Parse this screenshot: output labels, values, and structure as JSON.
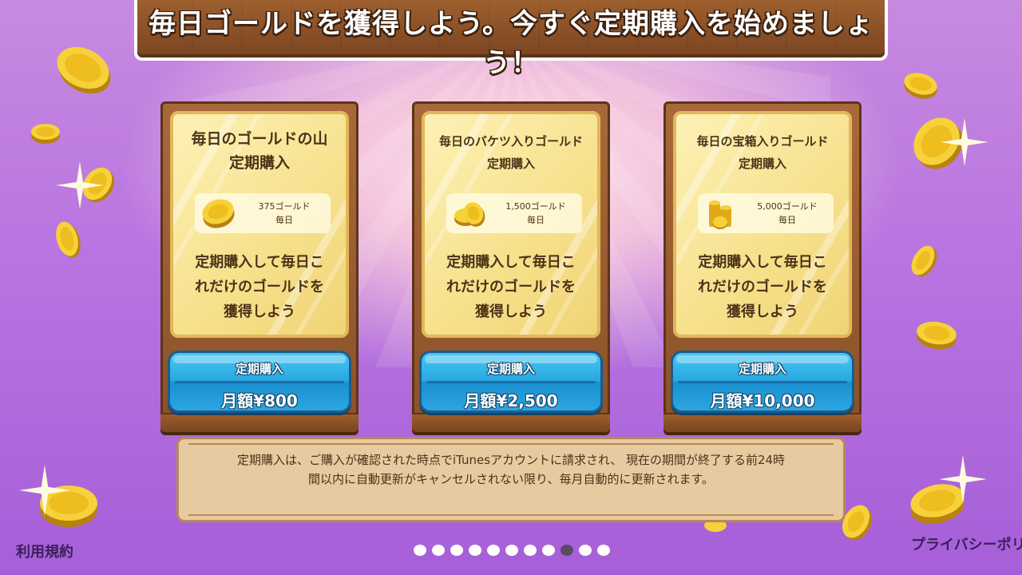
{
  "header": {
    "title": "毎日ゴールドを獲得しよう。今すぐ定期購入を始めましょう！"
  },
  "plans": [
    {
      "title_line1": "毎日のゴールドの山",
      "title_line2": "定期購入",
      "amount": "375ゴールド",
      "period": "毎日",
      "desc_line1": "定期購入して毎日こ",
      "desc_line2": "れだけのゴールドを",
      "desc_line3": "獲得しよう",
      "button_label": "定期購入",
      "price": "月額¥800",
      "icon": "single-coin-icon"
    },
    {
      "title_line1": "毎日のバケツ入りゴールド",
      "title_line2": "定期購入",
      "amount": "1,500ゴールド",
      "period": "毎日",
      "desc_line1": "定期購入して毎日こ",
      "desc_line2": "れだけのゴールドを",
      "desc_line3": "獲得しよう",
      "button_label": "定期購入",
      "price": "月額¥2,500",
      "icon": "coin-pair-icon"
    },
    {
      "title_line1": "毎日の宝箱入りゴールド",
      "title_line2": "定期購入",
      "amount": "5,000ゴールド",
      "period": "毎日",
      "desc_line1": "定期購入して毎日こ",
      "desc_line2": "れだけのゴールドを",
      "desc_line3": "獲得しよう",
      "button_label": "定期購入",
      "price": "月額¥10,000",
      "icon": "coin-stack-icon"
    }
  ],
  "notice": {
    "line1": "定期購入は、ご購入が確認された時点でiTunesアカウントに請求され、 現在の期間が終了する前24時",
    "line2": "間以内に自動更新がキャンセルされない限り、毎月自動的に更新されます。"
  },
  "footer": {
    "terms": "利用規約",
    "privacy": "プライバシーポリシー"
  },
  "pagination": {
    "total": 11,
    "active_index": 9
  },
  "colors": {
    "background": "#b874e0",
    "wood": "#8a5128",
    "card_face": "#f6e08b",
    "button_blue": "#27a8e0",
    "notice_bg": "#e7caa0",
    "active_dot": "#5a4a62"
  }
}
